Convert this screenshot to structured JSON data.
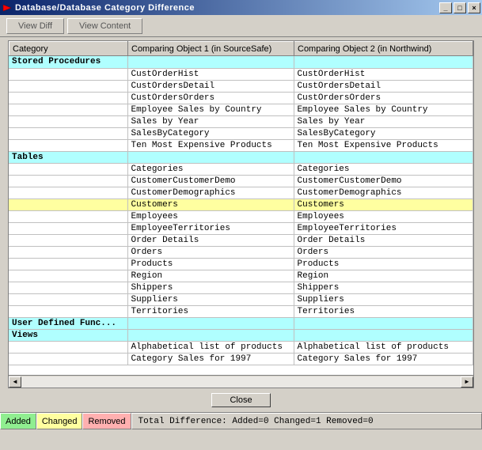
{
  "window": {
    "title": "Database/Database Category Difference"
  },
  "toolbar": {
    "view_diff": "View Diff",
    "view_content": "View Content"
  },
  "columns": {
    "category": "Category",
    "obj1": "Comparing Object 1 (in SourceSafe)",
    "obj2": "Comparing Object 2 (in Northwind)"
  },
  "rows": [
    {
      "type": "category",
      "category": "Stored Procedures",
      "obj1": "",
      "obj2": ""
    },
    {
      "type": "data",
      "category": "",
      "obj1": "CustOrderHist",
      "obj2": "CustOrderHist"
    },
    {
      "type": "data",
      "category": "",
      "obj1": "CustOrdersDetail",
      "obj2": "CustOrdersDetail"
    },
    {
      "type": "data",
      "category": "",
      "obj1": "CustOrdersOrders",
      "obj2": "CustOrdersOrders"
    },
    {
      "type": "data",
      "category": "",
      "obj1": "Employee Sales by Country",
      "obj2": "Employee Sales by Country"
    },
    {
      "type": "data",
      "category": "",
      "obj1": "Sales by Year",
      "obj2": "Sales by Year"
    },
    {
      "type": "data",
      "category": "",
      "obj1": "SalesByCategory",
      "obj2": "SalesByCategory"
    },
    {
      "type": "data",
      "category": "",
      "obj1": "Ten Most Expensive Products",
      "obj2": "Ten Most Expensive Products"
    },
    {
      "type": "category",
      "category": "Tables",
      "obj1": "",
      "obj2": ""
    },
    {
      "type": "data",
      "category": "",
      "obj1": "Categories",
      "obj2": "Categories"
    },
    {
      "type": "data",
      "category": "",
      "obj1": "CustomerCustomerDemo",
      "obj2": "CustomerCustomerDemo"
    },
    {
      "type": "data",
      "category": "",
      "obj1": "CustomerDemographics",
      "obj2": "CustomerDemographics"
    },
    {
      "type": "changed",
      "category": "",
      "obj1": "Customers",
      "obj2": "Customers"
    },
    {
      "type": "data",
      "category": "",
      "obj1": "Employees",
      "obj2": "Employees"
    },
    {
      "type": "data",
      "category": "",
      "obj1": "EmployeeTerritories",
      "obj2": "EmployeeTerritories"
    },
    {
      "type": "data",
      "category": "",
      "obj1": "Order Details",
      "obj2": "Order Details"
    },
    {
      "type": "data",
      "category": "",
      "obj1": "Orders",
      "obj2": "Orders"
    },
    {
      "type": "data",
      "category": "",
      "obj1": "Products",
      "obj2": "Products"
    },
    {
      "type": "data",
      "category": "",
      "obj1": "Region",
      "obj2": "Region"
    },
    {
      "type": "data",
      "category": "",
      "obj1": "Shippers",
      "obj2": "Shippers"
    },
    {
      "type": "data",
      "category": "",
      "obj1": "Suppliers",
      "obj2": "Suppliers"
    },
    {
      "type": "data",
      "category": "",
      "obj1": "Territories",
      "obj2": "Territories"
    },
    {
      "type": "category",
      "category": "User Defined Func...",
      "obj1": "",
      "obj2": ""
    },
    {
      "type": "category",
      "category": "Views",
      "obj1": "",
      "obj2": ""
    },
    {
      "type": "data",
      "category": "",
      "obj1": "Alphabetical list of products",
      "obj2": "Alphabetical list of products"
    },
    {
      "type": "data",
      "category": "",
      "obj1": "Category Sales for 1997",
      "obj2": "Category Sales for 1997"
    }
  ],
  "close_label": "Close",
  "legend": {
    "added": "Added",
    "changed": "Changed",
    "removed": "Removed"
  },
  "status_text": "Total Difference: Added=0  Changed=1  Removed=0"
}
